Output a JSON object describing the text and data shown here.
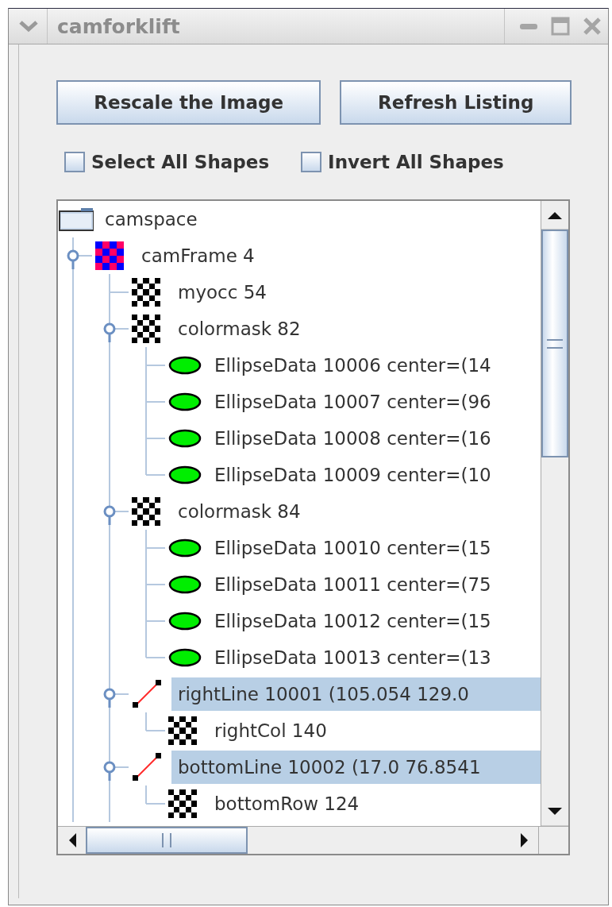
{
  "window": {
    "title": "camforklift"
  },
  "buttons": [
    {
      "label": "Rescale the Image"
    },
    {
      "label": "Refresh Listing"
    }
  ],
  "checkboxes": [
    {
      "label": "Select All Shapes",
      "checked": false
    },
    {
      "label": "Invert All Shapes",
      "checked": false
    }
  ],
  "tree": {
    "nodes": [
      {
        "label": "camspace",
        "kind": "folder",
        "selected": false,
        "list_continues": true,
        "children": [
          {
            "label": "camFrame 4",
            "kind": "frame",
            "selected": false,
            "expanded": true,
            "list_continues": true,
            "children": [
              {
                "label": "myocc 54",
                "kind": "mask",
                "selected": false
              },
              {
                "label": "colormask 82",
                "kind": "mask",
                "selected": false,
                "expanded": true,
                "children": [
                  {
                    "label": "EllipseData 10006 center=(14",
                    "kind": "ellipse",
                    "selected": false
                  },
                  {
                    "label": "EllipseData 10007 center=(96",
                    "kind": "ellipse",
                    "selected": false
                  },
                  {
                    "label": "EllipseData 10008 center=(16",
                    "kind": "ellipse",
                    "selected": false
                  },
                  {
                    "label": "EllipseData 10009 center=(10",
                    "kind": "ellipse",
                    "selected": false
                  }
                ]
              },
              {
                "label": "colormask 84",
                "kind": "mask",
                "selected": false,
                "expanded": true,
                "children": [
                  {
                    "label": "EllipseData 10010 center=(15",
                    "kind": "ellipse",
                    "selected": false
                  },
                  {
                    "label": "EllipseData 10011 center=(75",
                    "kind": "ellipse",
                    "selected": false
                  },
                  {
                    "label": "EllipseData 10012 center=(15",
                    "kind": "ellipse",
                    "selected": false
                  },
                  {
                    "label": "EllipseData 10013 center=(13",
                    "kind": "ellipse",
                    "selected": false
                  }
                ]
              },
              {
                "label": "rightLine 10001 (105.054 129.0",
                "kind": "line",
                "selected": true,
                "expanded": true,
                "children": [
                  {
                    "label": "rightCol 140",
                    "kind": "mask",
                    "selected": false
                  }
                ]
              },
              {
                "label": "bottomLine 10002 (17.0 76.8541",
                "kind": "line",
                "selected": true,
                "expanded": true,
                "children": [
                  {
                    "label": "bottomRow 124",
                    "kind": "mask",
                    "selected": false
                  }
                ]
              }
            ]
          }
        ]
      }
    ]
  }
}
